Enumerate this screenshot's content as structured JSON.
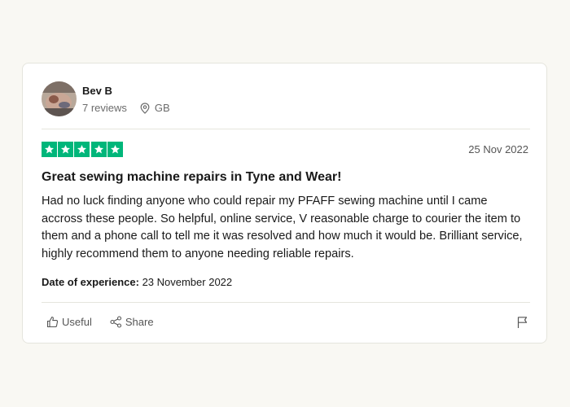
{
  "reviewer": {
    "name": "Bev B",
    "reviews": "7 reviews",
    "country": "GB"
  },
  "rating": {
    "stars": 5,
    "max": 5,
    "color": "#00b67a"
  },
  "review": {
    "date": "25 Nov 2022",
    "title": "Great sewing machine repairs in Tyne and Wear!",
    "body": "Had no luck finding anyone who could repair my PFAFF sewing machine until I came accross these people. So helpful, online service, V reasonable charge to courier the item to them and a phone call to tell me it was resolved and how much it would be. Brilliant service, highly recommend them to anyone needing reliable repairs.",
    "experience_label": "Date of experience:",
    "experience_date": "23 November 2022"
  },
  "actions": {
    "useful": "Useful",
    "share": "Share",
    "icons": [
      "thumbs-up-icon",
      "share-icon",
      "flag-icon"
    ]
  }
}
